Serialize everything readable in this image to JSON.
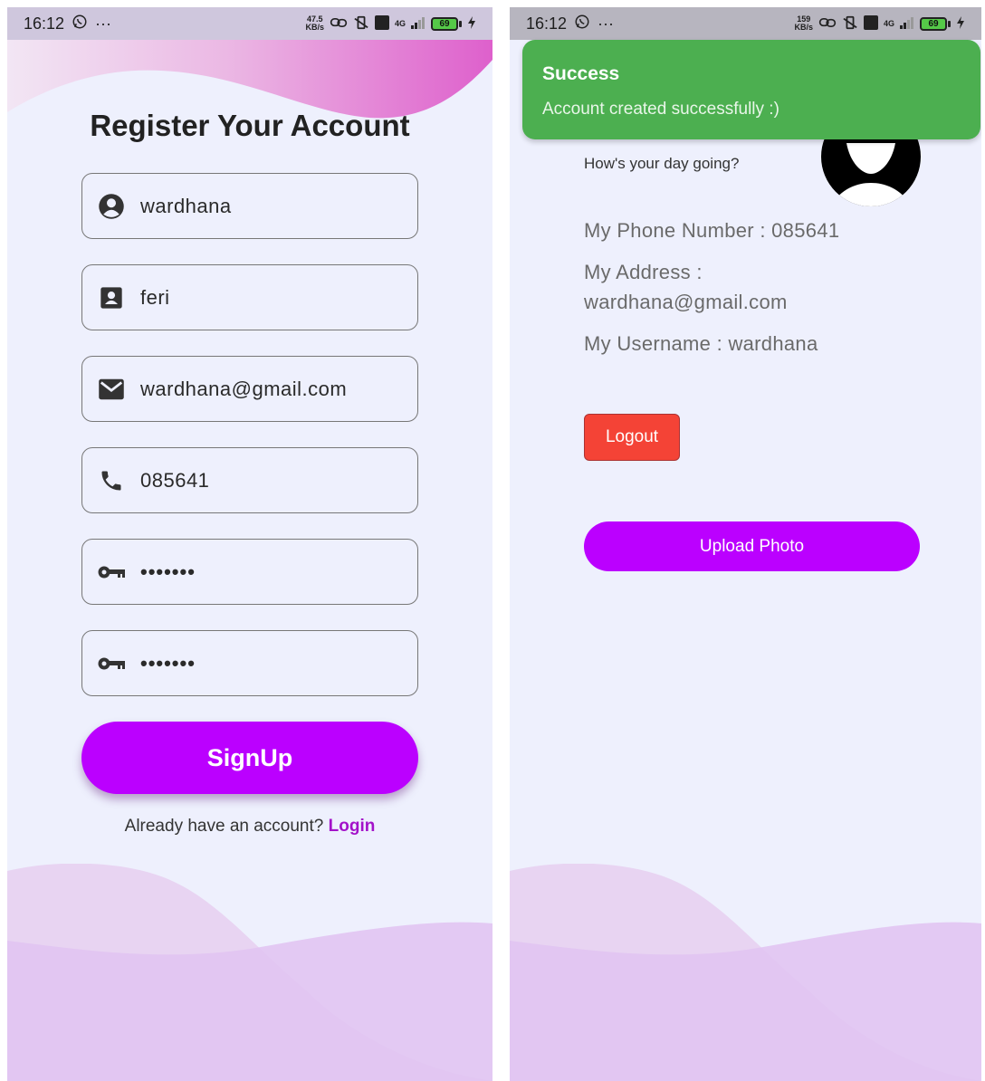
{
  "status_bar_left": {
    "time": "16:12",
    "more": "···",
    "speed_value": "47.5",
    "speed_unit": "KB/s",
    "network": "4G",
    "battery": "69"
  },
  "status_bar_right": {
    "time": "16:12",
    "more": "···",
    "speed_value": "159",
    "speed_unit": "KB/s",
    "network": "4G",
    "battery": "69"
  },
  "register": {
    "title": "Register Your Account",
    "fields": [
      {
        "icon": "account-circle-icon",
        "value": "wardhana"
      },
      {
        "icon": "contact-card-icon",
        "value": "feri"
      },
      {
        "icon": "email-icon",
        "value": "wardhana@gmail.com"
      },
      {
        "icon": "phone-icon",
        "value": "085641"
      },
      {
        "icon": "key-icon",
        "value": "•••••••"
      },
      {
        "icon": "key-icon",
        "value": "•••••••"
      }
    ],
    "signup_label": "SignUp",
    "login_prompt": "Already have an account?",
    "login_link": "Login"
  },
  "profile": {
    "toast_title": "Success",
    "toast_message": "Account created successfully :)",
    "greeting": "How's your day going?",
    "phone_line": "My Phone Number : 085641",
    "address_label": "My Address :",
    "address_value": "wardhana@gmail.com",
    "username_line": "My Username : wardhana",
    "logout_label": "Logout",
    "upload_label": "Upload Photo"
  },
  "colors": {
    "background": "#eef0fd",
    "accent": "#bb00ff",
    "link": "#a312c9",
    "success": "#4caf50",
    "danger": "#f44336",
    "wave_light": "#e8d4f2",
    "wave_dark": "#e1c4f2"
  }
}
